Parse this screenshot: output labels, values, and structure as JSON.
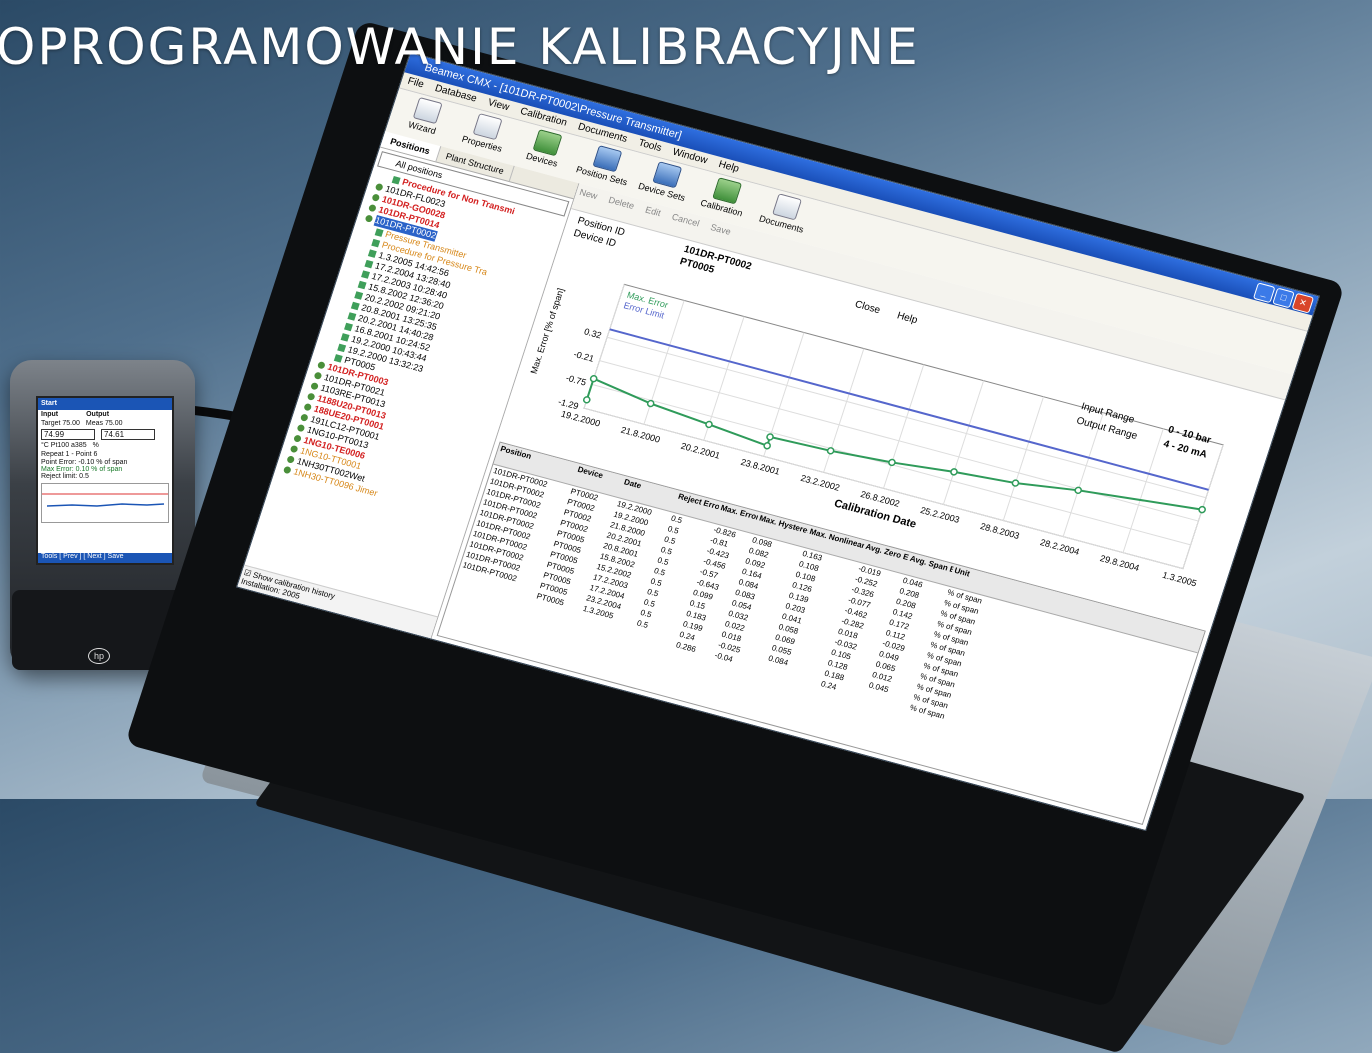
{
  "headline": "OPROGRAMOWANIE KALIBRACYJNE",
  "pda": {
    "title": "Start",
    "col_input": "Input",
    "col_output": "Output",
    "target_label": "Target 75.00",
    "meas_label": "Meas 75.00",
    "input_value": "74.99",
    "output_value": "74.61",
    "units_input": "°C Pt100 a385",
    "units_output": "%",
    "line1": "Repeat 1 - Point 6",
    "line2": "Point Error: -0.10 % of span",
    "line3": "Max Error: 0.10 % of span",
    "line4": "Reject limit: 0.5",
    "bottom_bar": "Tools  [ Prev ]  [ Next ]  Save",
    "logo": "hp"
  },
  "app": {
    "title": "Beamex CMX - [101DR-PT0002\\Pressure Transmitter]",
    "menu": [
      "File",
      "Database",
      "View",
      "Calibration",
      "Documents",
      "Tools",
      "Window",
      "Help"
    ],
    "toolbar": [
      {
        "label": "Wizard",
        "icon": "wizard-icon"
      },
      {
        "label": "Properties",
        "icon": "properties-icon"
      },
      {
        "label": "Devices",
        "icon": "devices-icon"
      },
      {
        "label": "Position Sets",
        "icon": "position-sets-icon"
      },
      {
        "label": "Device Sets",
        "icon": "device-sets-icon"
      },
      {
        "label": "Calibration",
        "icon": "calibration-icon"
      },
      {
        "label": "Documents",
        "icon": "documents-icon"
      }
    ],
    "left_tabs": [
      "Positions",
      "Plant Structure"
    ],
    "filter": "All positions",
    "tree": [
      {
        "text": "Procedure for Non Transmi",
        "cls": "red",
        "icon": "check"
      },
      {
        "text": "101DR-FL0023",
        "cls": "",
        "icon": "node"
      },
      {
        "text": "101DR-GO0028",
        "cls": "red",
        "icon": "node"
      },
      {
        "text": "101DR-PT0014",
        "cls": "red",
        "icon": "node"
      },
      {
        "text": "101DR-PT0002",
        "cls": "sel",
        "icon": "node"
      },
      {
        "text": "Pressure Transmitter",
        "cls": "orange",
        "icon": "sq"
      },
      {
        "text": "Procedure for Pressure Tra",
        "cls": "orange",
        "icon": "check"
      },
      {
        "text": "1.3.2005 14:42:56",
        "cls": "",
        "icon": "sq"
      },
      {
        "text": "17.2.2004 13:28:40",
        "cls": "",
        "icon": "sq"
      },
      {
        "text": "17.2.2003 10:28:40",
        "cls": "",
        "icon": "sq"
      },
      {
        "text": "15.8.2002 12:36:20",
        "cls": "",
        "icon": "sq"
      },
      {
        "text": "20.2.2002 09:21:20",
        "cls": "",
        "icon": "sq"
      },
      {
        "text": "20.8.2001 13:25:35",
        "cls": "",
        "icon": "sq"
      },
      {
        "text": "20.2.2001 14:40:28",
        "cls": "",
        "icon": "sq"
      },
      {
        "text": "16.8.2001 10:24:52",
        "cls": "",
        "icon": "sq"
      },
      {
        "text": "19.2.2000 10:43:44",
        "cls": "",
        "icon": "sq"
      },
      {
        "text": "19.2.2000 13:32:23",
        "cls": "",
        "icon": "sq"
      },
      {
        "text": "PT0005",
        "cls": "",
        "icon": "sq"
      },
      {
        "text": "101DR-PT0003",
        "cls": "red",
        "icon": "node"
      },
      {
        "text": "101DR-PT0021",
        "cls": "",
        "icon": "node"
      },
      {
        "text": "1103RE-PT0013",
        "cls": "",
        "icon": "node"
      },
      {
        "text": "1188U20-PT0013",
        "cls": "red",
        "icon": "node"
      },
      {
        "text": "188UE20-PT0001",
        "cls": "red",
        "icon": "node"
      },
      {
        "text": "191LC12-PT0001",
        "cls": "",
        "icon": "node"
      },
      {
        "text": "1NG10-PT0013",
        "cls": "",
        "icon": "node"
      },
      {
        "text": "1NG10-TE0006",
        "cls": "red",
        "icon": "node"
      },
      {
        "text": "1NG10-TT0001",
        "cls": "orange",
        "icon": "node"
      },
      {
        "text": "1NH30TT002Wet",
        "cls": "",
        "icon": "node"
      },
      {
        "text": "1NH30-TT0096 Jimer",
        "cls": "orange",
        "icon": "node"
      }
    ],
    "show_history": "Show calibration history",
    "status": "Installation: 2005",
    "subtoolbar": [
      "New",
      "Delete",
      "Edit",
      "Cancel",
      "Save"
    ],
    "position_id_label": "Position ID",
    "device_id_label": "Device ID",
    "position_id": "101DR-PT0002",
    "device_id": "PT0005",
    "close_label": "Close",
    "help_label": "Help",
    "legend_max": "Max. Error",
    "legend_limit": "Error Limit",
    "input_range_label": "Input Range",
    "output_range_label": "Output Range",
    "input_range": "0 - 10 bar",
    "output_range": "4 - 20 mA",
    "table_headers": [
      "Position",
      "Device",
      "Date",
      "Reject Error",
      "Max. Error",
      "Max. Hysteresis",
      "Max. Nonlinearity",
      "Avg. Zero Error",
      "Avg. Span Error",
      "Unit"
    ],
    "table_rows": [
      [
        "101DR-PT0002",
        "PT0002",
        "19.2.2000",
        "0.5",
        "-0.826",
        "0.098",
        "0.163",
        "-0.019",
        "0.046",
        "% of span"
      ],
      [
        "101DR-PT0002",
        "PT0002",
        "19.2.2000",
        "0.5",
        "-0.81",
        "0.082",
        "0.108",
        "-0.252",
        "0.208",
        "% of span"
      ],
      [
        "101DR-PT0002",
        "PT0002",
        "21.8.2000",
        "0.5",
        "-0.423",
        "0.092",
        "0.108",
        "-0.326",
        "0.208",
        "% of span"
      ],
      [
        "101DR-PT0002",
        "PT0002",
        "20.2.2001",
        "0.5",
        "-0.456",
        "0.164",
        "0.126",
        "-0.077",
        "0.142",
        "% of span"
      ],
      [
        "101DR-PT0002",
        "PT0005",
        "20.8.2001",
        "0.5",
        "-0.57",
        "0.084",
        "0.139",
        "-0.462",
        "0.172",
        "% of span"
      ],
      [
        "101DR-PT0002",
        "PT0005",
        "15.8.2002",
        "0.5",
        "-0.643",
        "0.083",
        "0.203",
        "-0.282",
        "0.112",
        "% of span"
      ],
      [
        "101DR-PT0002",
        "PT0005",
        "15.2.2002",
        "0.5",
        "0.099",
        "0.054",
        "0.041",
        "0.018",
        "-0.029",
        "% of span"
      ],
      [
        "101DR-PT0002",
        "PT0005",
        "17.2.2003",
        "0.5",
        "0.15",
        "0.032",
        "0.058",
        "-0.032",
        "0.049",
        "% of span"
      ],
      [
        "101DR-PT0002",
        "PT0005",
        "17.2.2004",
        "0.5",
        "0.183",
        "0.022",
        "0.069",
        "0.105",
        "0.065",
        "% of span"
      ],
      [
        "101DR-PT0002",
        "PT0005",
        "23.2.2004",
        "0.5",
        "0.199",
        "0.018",
        "0.055",
        "0.128",
        "0.012",
        "% of span"
      ],
      [
        "",
        "PT0005",
        "1.3.2005",
        "0.5",
        "0.24",
        "-0.025",
        "0.084",
        "0.188",
        "0.045",
        "% of span"
      ],
      [
        "",
        "",
        "",
        "",
        "0.286",
        "-0.04",
        "",
        "0.24",
        "",
        "% of span"
      ]
    ]
  },
  "chart_data": {
    "type": "line",
    "title": "",
    "xlabel": "Calibration Date",
    "ylabel": "Max. Error [% of span]",
    "x": [
      "19.2.2000",
      "21.8.2000",
      "20.2.2001",
      "23.8.2001",
      "23.2.2002",
      "26.8.2002",
      "25.2.2003",
      "28.8.2003",
      "28.2.2004",
      "29.8.2004",
      "1.3.2005"
    ],
    "y_ticks": [
      "0.32",
      "-0.21",
      "-0.75",
      "-1.29"
    ],
    "ylim": [
      -1.29,
      0.32
    ],
    "series": [
      {
        "name": "Max. Error",
        "color": "#2f9b5a",
        "points": [
          [
            "19.2.2000",
            -1.1
          ],
          [
            "19.2.2000",
            -0.62
          ],
          [
            "21.8.2000",
            -0.82
          ],
          [
            "20.2.2001",
            -0.93
          ],
          [
            "23.8.2001",
            -1.05
          ],
          [
            "23.8.2001",
            -0.85
          ],
          [
            "23.2.2002",
            -0.8
          ],
          [
            "26.8.2002",
            -0.7
          ],
          [
            "25.2.2003",
            -0.55
          ],
          [
            "28.8.2003",
            -0.44
          ],
          [
            "28.2.2004",
            -0.24
          ],
          [
            "1.3.2005",
            0.05
          ]
        ]
      },
      {
        "name": "Error Limit",
        "color": "#5566cc",
        "points": [
          [
            "19.2.2000",
            0.5
          ],
          [
            "1.3.2005",
            0.5
          ]
        ]
      }
    ],
    "legend": "top-left",
    "grid": true
  },
  "colors": {
    "accent": "#1a4fb8",
    "error_line": "#2f9b5a",
    "limit_line": "#5566cc",
    "alarm": "#d32020"
  }
}
